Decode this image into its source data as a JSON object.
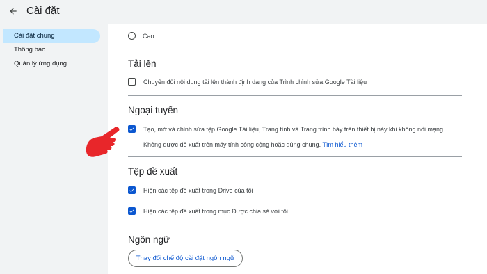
{
  "header": {
    "title": "Cài đặt",
    "back_icon": "arrow-back-icon"
  },
  "sidebar": {
    "items": [
      {
        "label": "Cài đặt chung",
        "active": true
      },
      {
        "label": "Thông báo",
        "active": false
      },
      {
        "label": "Quản lý ứng dụng",
        "active": false
      }
    ]
  },
  "main": {
    "radio_option": {
      "label": "Cao",
      "selected": false
    },
    "upload": {
      "title": "Tải lên",
      "convert_label": "Chuyển đổi nội dung tải lên thành định dạng của Trình chỉnh sửa Google Tài liệu",
      "convert_checked": false
    },
    "offline": {
      "title": "Ngoại tuyến",
      "label": "Tạo, mở và chỉnh sửa tệp Google Tài liệu, Trang tính và Trang trình bày trên thiết bị này khi không nối mạng.",
      "checked": true,
      "note": "Không được đề xuất trên máy tính công cộng hoặc dùng chung.",
      "learn_more": "Tìm hiểu thêm"
    },
    "suggested": {
      "title": "Tệp đề xuất",
      "items": [
        {
          "label": "Hiện các tệp đề xuất trong Drive của tôi",
          "checked": true
        },
        {
          "label": "Hiện các tệp đề xuất trong mục Được chia sẻ với tôi",
          "checked": true
        }
      ]
    },
    "language": {
      "title": "Ngôn ngữ",
      "button_label": "Thay đổi chế độ cài đặt ngôn ngữ"
    }
  },
  "colors": {
    "accent": "#0b57d0",
    "active_nav": "#c2e7ff",
    "pointer": "#e8262a"
  }
}
